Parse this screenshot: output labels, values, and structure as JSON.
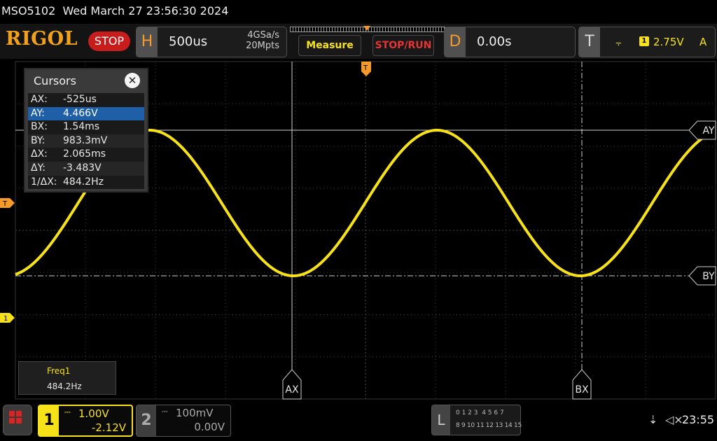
{
  "header": {
    "title": "MSO5102  Wed March 27 23:56:30 2024",
    "brand": "RIGOL",
    "run_state": "STOP"
  },
  "horizontal": {
    "label": "H",
    "timebase": "500us",
    "sample_rate": "4GSa/s",
    "memory_depth": "20Mpts"
  },
  "buttons": {
    "measure": "Measure",
    "stop_run": "STOP/RUN"
  },
  "delay": {
    "label": "D",
    "value": "0.00s"
  },
  "trigger": {
    "label": "T",
    "edge_icon": "rising-edge-icon",
    "edge_glyph": "⨪",
    "source": "1",
    "level": "2.75V",
    "mode": "A"
  },
  "cursors_panel": {
    "title": "Cursors",
    "close_glyph": "✕",
    "rows": [
      {
        "key": "AX:",
        "value": "-525us"
      },
      {
        "key": "AY:",
        "value": "4.466V"
      },
      {
        "key": "BX:",
        "value": "1.54ms"
      },
      {
        "key": "BY:",
        "value": "983.3mV"
      },
      {
        "key": "ΔX:",
        "value": "2.065ms"
      },
      {
        "key": "ΔY:",
        "value": "-3.483V"
      },
      {
        "key": "1/ΔX:",
        "value": "484.2Hz"
      }
    ],
    "selected_row": 1
  },
  "cursor_markers": {
    "ax": "AX",
    "bx": "BX",
    "ay": "AY",
    "by": "BY"
  },
  "side_markers": {
    "trigger": "T",
    "channel1": "1",
    "trigger_top": "T"
  },
  "measurement": {
    "label": "Freq1",
    "value": "484.2Hz"
  },
  "channel1": {
    "number": "1",
    "coupling": "DC",
    "scale": "1.00V",
    "offset": "-2.12V",
    "color": "#f7e21a"
  },
  "channel2": {
    "number": "2",
    "coupling": "DC",
    "scale": "100mV",
    "offset": "0.00V"
  },
  "logic": {
    "label": "L",
    "row1": "0 1 2 3  4 5 6 7",
    "row2": "8 9 10 11 12 13 14 15"
  },
  "status": {
    "usb_icon": "usb-icon",
    "usb_glyph": "⇣",
    "speaker_icon": "speaker-muted-icon",
    "speaker_glyph": "◁×",
    "clock": "23:55"
  },
  "waveform": {
    "channel": "1",
    "frequency_hz": 484.2,
    "max_v": 4.466,
    "min_v": 0.983,
    "color": "#f7e21a"
  }
}
